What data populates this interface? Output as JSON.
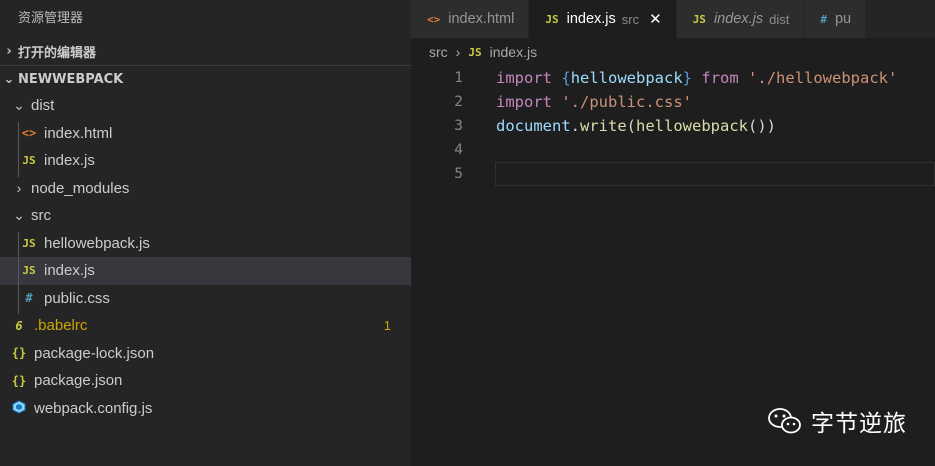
{
  "sidebar": {
    "title": "资源管理器",
    "open_editors": "打开的编辑器",
    "project": "NEWWEBPACK",
    "items": [
      {
        "label": "dist",
        "type": "folder",
        "icon": "chevron-down-icon"
      },
      {
        "label": "index.html",
        "type": "html",
        "icon": "<>"
      },
      {
        "label": "index.js",
        "type": "js",
        "icon": "JS"
      },
      {
        "label": "node_modules",
        "type": "folder",
        "icon": "chevron-right-icon"
      },
      {
        "label": "src",
        "type": "folder",
        "icon": "chevron-down-icon"
      },
      {
        "label": "hellowebpack.js",
        "type": "js",
        "icon": "JS"
      },
      {
        "label": "index.js",
        "type": "js",
        "icon": "JS"
      },
      {
        "label": "public.css",
        "type": "css",
        "icon": "#"
      },
      {
        "label": ".babelrc",
        "type": "babel",
        "icon": "6",
        "badge": "1"
      },
      {
        "label": "package-lock.json",
        "type": "json",
        "icon": "{}"
      },
      {
        "label": "package.json",
        "type": "json",
        "icon": "{}"
      },
      {
        "label": "webpack.config.js",
        "type": "webpack",
        "icon": "webpack-icon"
      }
    ]
  },
  "tabs": [
    {
      "label": "index.html",
      "icon": "<>",
      "desc": ""
    },
    {
      "label": "index.js",
      "icon": "JS",
      "desc": "src",
      "active": true
    },
    {
      "label": "index.js",
      "icon": "JS",
      "desc": "dist"
    },
    {
      "label": "pu",
      "icon": "#",
      "desc": ""
    }
  ],
  "breadcrumb": {
    "folder": "src",
    "file": "index.js",
    "icon": "JS"
  },
  "code": {
    "line_numbers": [
      "1",
      "2",
      "3",
      "4",
      "5"
    ],
    "l1": {
      "kw": "import",
      "open": "{",
      "name": "hellowebpack",
      "close": "}",
      "from": "from",
      "path": "'./hellowebpack'"
    },
    "l2": {
      "kw": "import",
      "path": "'./public.css'"
    },
    "l3": {
      "obj": "document",
      "dot": ".",
      "method": "write",
      "open": "(",
      "arg": "hellowebpack",
      "call": "()",
      "close": ")"
    }
  },
  "watermark": {
    "text": "字节逆旅"
  },
  "colors": {
    "sidebar_bg": "#252526",
    "editor_bg": "#1e1e1e",
    "selected_bg": "#37373d",
    "js_icon": "#cbcb41",
    "html_icon": "#e37933",
    "css_icon": "#519aba"
  }
}
